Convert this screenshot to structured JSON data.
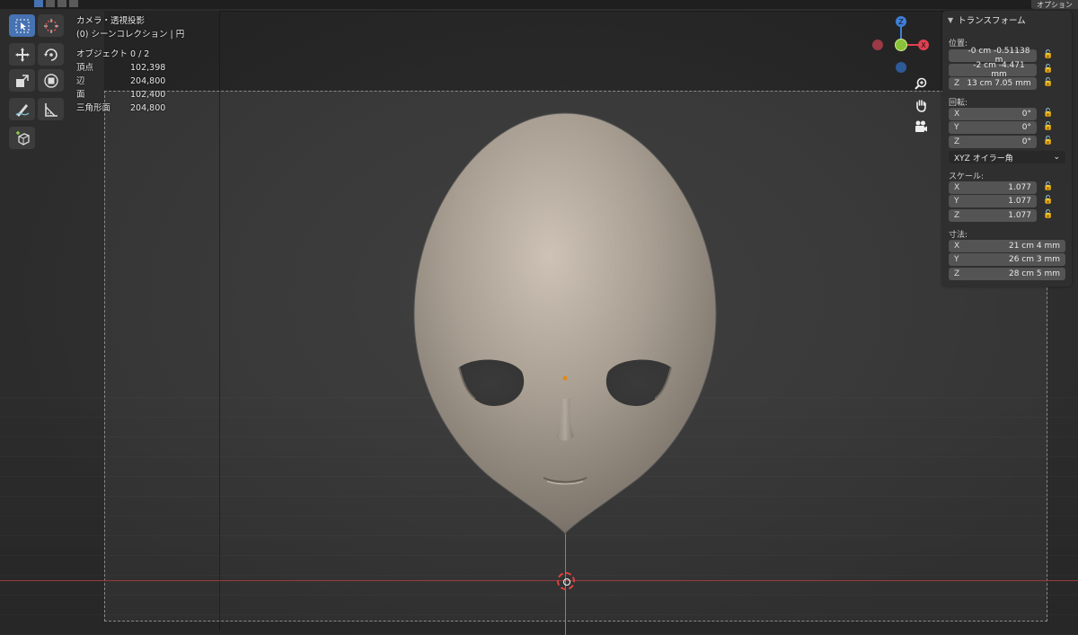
{
  "overlay": {
    "view_name": "カメラ・透視投影",
    "collection": "(0) シーンコレクション | 円"
  },
  "stats": [
    {
      "label": "オブジェクト",
      "value": "0 / 2"
    },
    {
      "label": "頂点",
      "value": "102,398"
    },
    {
      "label": "辺",
      "value": "204,800"
    },
    {
      "label": "面",
      "value": "102,400"
    },
    {
      "label": "三角形面",
      "value": "204,800"
    }
  ],
  "header": {
    "options_label": "オプション"
  },
  "gizmo": {
    "z_label": "Z",
    "x_label": "X"
  },
  "npanel": {
    "title": "トランスフォーム",
    "location_label": "位置:",
    "location": [
      {
        "axis": "",
        "value": "-0 cm -0.51138 m"
      },
      {
        "axis": "",
        "value": "-2 cm -4.471 mm"
      },
      {
        "axis": "Z",
        "value": "13 cm 7.05 mm"
      }
    ],
    "rotation_label": "回転:",
    "rotation": [
      {
        "axis": "X",
        "value": "0°"
      },
      {
        "axis": "Y",
        "value": "0°"
      },
      {
        "axis": "Z",
        "value": "0°"
      }
    ],
    "rotation_mode": "XYZ オイラー角",
    "scale_label": "スケール:",
    "scale": [
      {
        "axis": "X",
        "value": "1.077"
      },
      {
        "axis": "Y",
        "value": "1.077"
      },
      {
        "axis": "Z",
        "value": "1.077"
      }
    ],
    "dimensions_label": "寸法:",
    "dimensions": [
      {
        "axis": "X",
        "value": "21 cm 4 mm"
      },
      {
        "axis": "Y",
        "value": "26 cm 3 mm"
      },
      {
        "axis": "Z",
        "value": "28 cm 5 mm"
      }
    ]
  },
  "icons": {
    "tools": [
      "select-box-icon",
      "cursor-icon",
      "move-icon",
      "rotate-icon",
      "scale-icon",
      "transform-icon",
      "annotate-icon",
      "measure-icon",
      "add-cube-icon"
    ],
    "nav": [
      "zoom-icon",
      "hand-pan-icon",
      "camera-view-icon"
    ]
  },
  "colors": {
    "accent": "#4772b3",
    "axis_x": "#e04050",
    "axis_y": "#8ac03a",
    "axis_z": "#3f7fd8"
  }
}
